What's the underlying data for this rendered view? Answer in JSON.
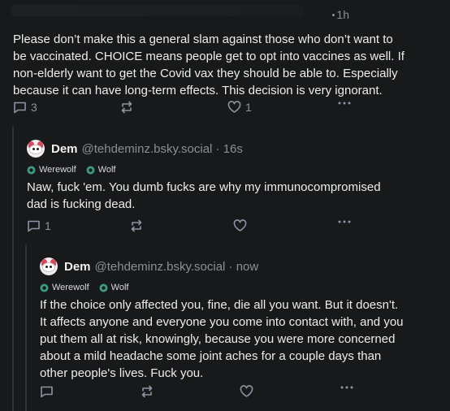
{
  "top": {
    "time": "1h"
  },
  "post1": {
    "lines": [
      "Please don’t make this a general slam against those who don’t want to",
      "be vaccinated. CHOICE means people get to opt into vaccines as well. If",
      "non-elderly want to get the Covid vax they should be able to. Especially",
      "because it can have long-term effects. This decision is very ignorant."
    ],
    "reply_count": "3",
    "like_count": "1"
  },
  "post2": {
    "name": "Dem",
    "handle": "@tehdeminz.bsky.social · 16s",
    "tags": [
      "Werewolf",
      "Wolf"
    ],
    "lines": [
      "Naw, fuck 'em. You dumb fucks are why my immunocompromised",
      "dad is fucking dead."
    ],
    "reply_count": "1"
  },
  "post3": {
    "name": "Dem",
    "handle": "@tehdeminz.bsky.social · now",
    "tags": [
      "Werewolf",
      "Wolf"
    ],
    "lines": [
      "If the choice only affected you, fine, die all you want. But it doesn't.",
      "It affects anyone and everyone you come into contact with, and you",
      "put them all at risk, knowingly, because you were more concerned",
      "about a mild headache some joint aches for a couple days than",
      "other people's lives. Fuck you."
    ]
  }
}
